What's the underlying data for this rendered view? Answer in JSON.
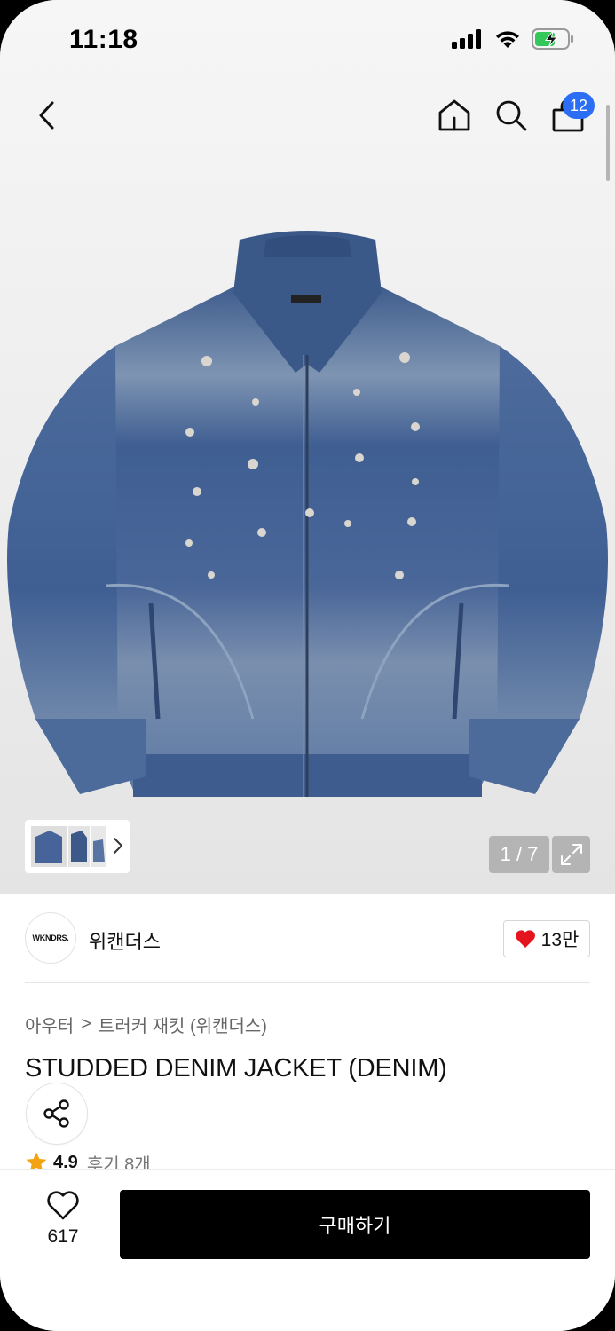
{
  "status_bar": {
    "time": "11:18"
  },
  "nav": {
    "cart_count": "12"
  },
  "gallery": {
    "pager": "1 / 7"
  },
  "brand": {
    "logo_text": "WKNDRS.",
    "name": "위캔더스",
    "like_count": "13만"
  },
  "breadcrumb": {
    "category": "아우터",
    "separator": ">",
    "subcategory": "트러커 재킷 (위캔더스)"
  },
  "product": {
    "title": "STUDDED DENIM JACKET (DENIM)",
    "rating": "4.9",
    "review_label": "후기 8개"
  },
  "bottom_bar": {
    "wish_count": "617",
    "buy_label": "구매하기"
  },
  "icons": {
    "back": "chevron-left-icon",
    "home": "home-icon",
    "search": "search-icon",
    "bag": "shopping-bag-icon",
    "expand": "expand-icon",
    "share": "share-icon",
    "heart": "heart-icon",
    "star": "star-icon"
  },
  "colors": {
    "badge": "#2b6ef5",
    "heart_red": "#e4141f",
    "star": "#f3a213",
    "buy_button": "#000000",
    "denim": "#3f5f93"
  }
}
